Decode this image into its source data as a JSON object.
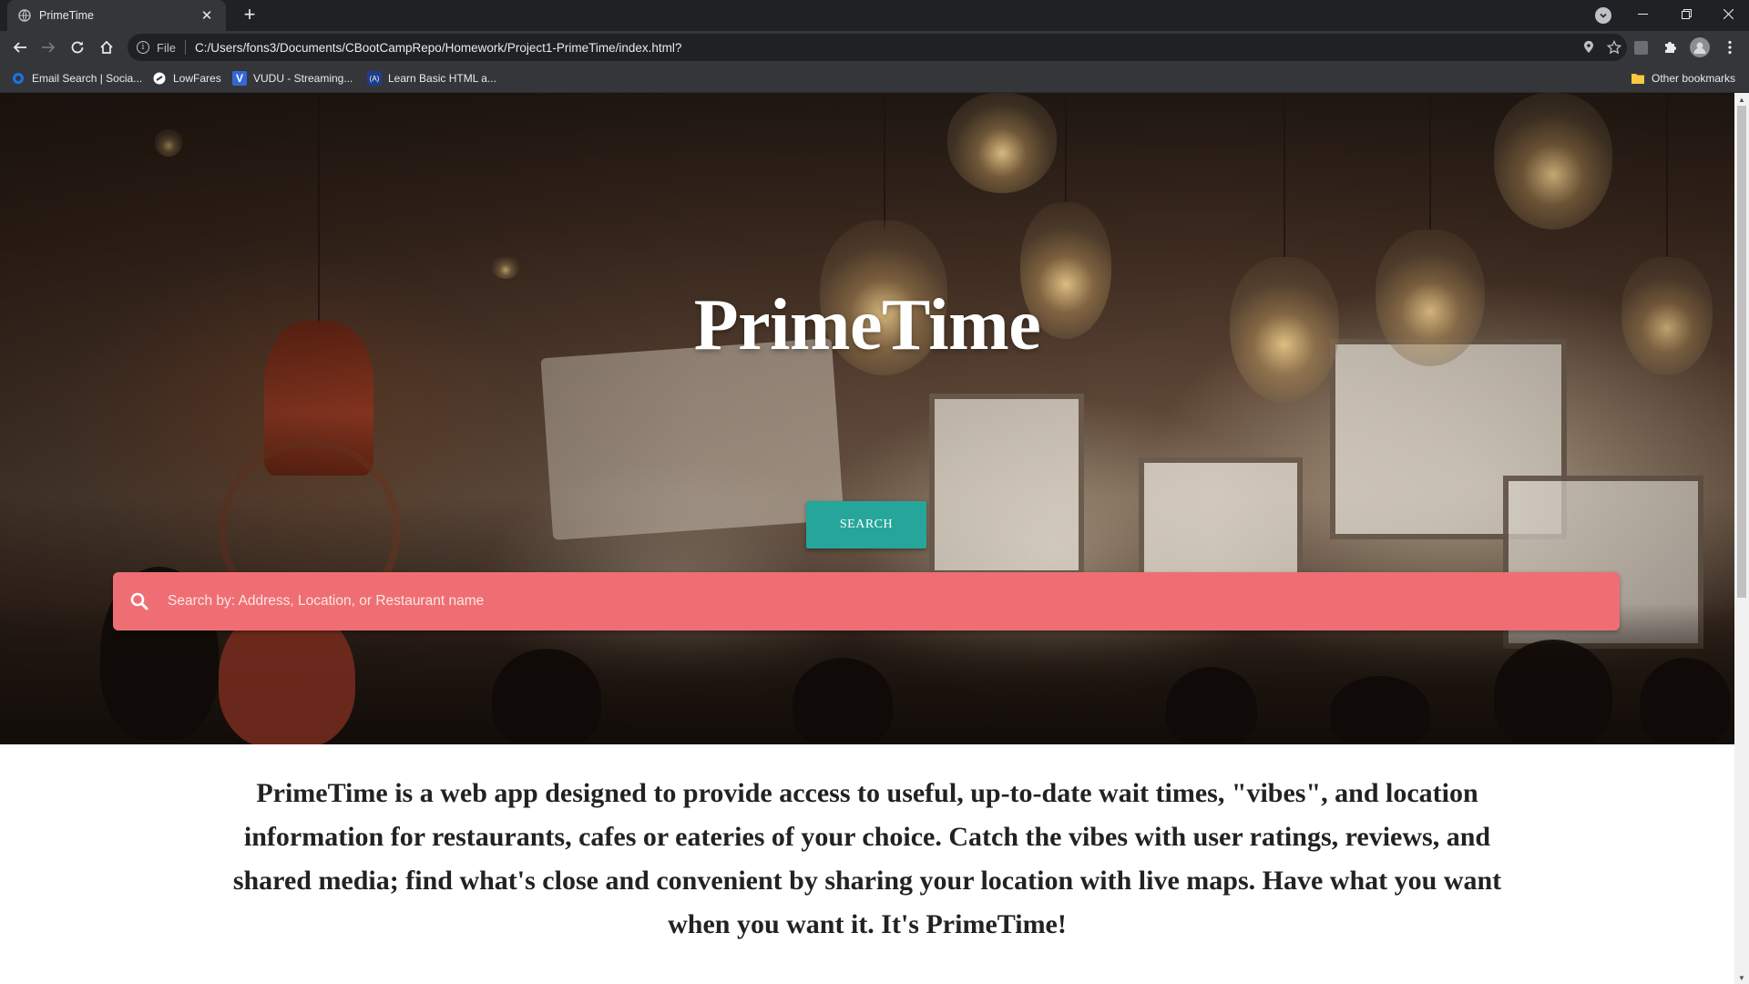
{
  "browser": {
    "tab_title": "PrimeTime",
    "tab_close": "✕",
    "new_tab": "+",
    "omnibox_scheme": "File",
    "url": "C:/Users/fons3/Documents/CBootCampRepo/Homework/Project1-PrimeTime/index.html?",
    "bookmarks": [
      {
        "label": "Email Search | Socia...",
        "icon": "globe-icon",
        "color": "#1a73e8"
      },
      {
        "label": "LowFares",
        "icon": "lowfares-icon",
        "color": "#ffffff"
      },
      {
        "label": "VUDU - Streaming...",
        "icon": "vudu-icon",
        "color": "#3367d6"
      },
      {
        "label": "Learn Basic HTML a...",
        "icon": "codecademy-icon",
        "color": "#1f3c88"
      }
    ],
    "other_bookmarks": "Other bookmarks"
  },
  "page": {
    "title": "PrimeTime",
    "search_button": "SEARCH",
    "search_placeholder": "Search by: Address, Location, or Restaurant name",
    "description": "PrimeTime is a web app designed to provide access to useful, up-to-date wait times, \"vibes\", and location information for restaurants, cafes or eateries of your choice. Catch the vibes with user ratings, reviews, and shared media; find what's close and convenient by sharing your location with live maps. Have what you want when you want it. It's PrimeTime!"
  },
  "colors": {
    "search_button": "#26a69a",
    "search_bar": "#ef6e73",
    "chrome_dark": "#202124",
    "chrome_toolbar": "#35363a"
  }
}
